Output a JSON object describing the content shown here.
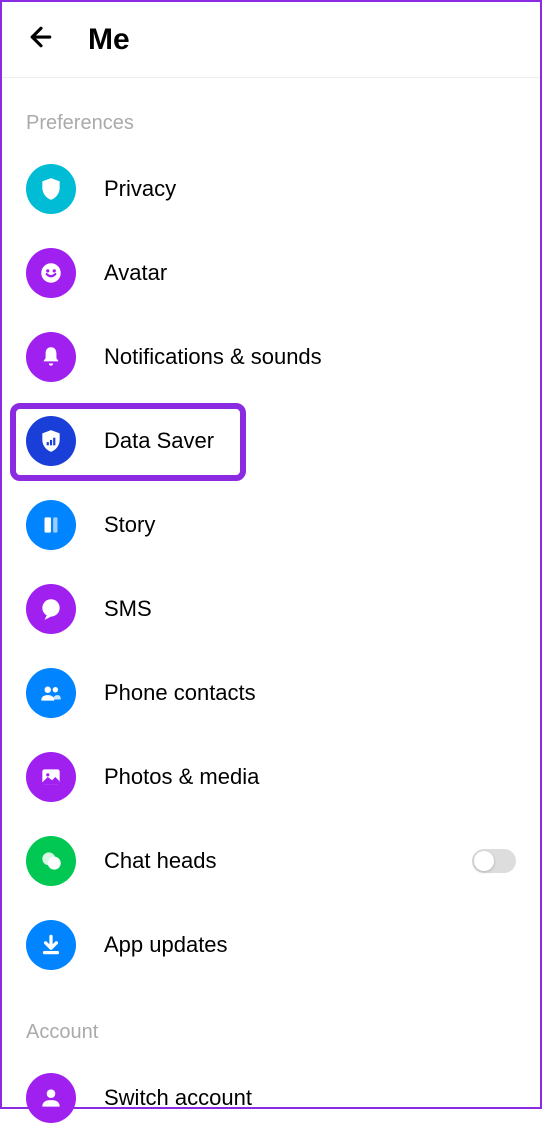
{
  "header": {
    "title": "Me"
  },
  "sections": {
    "preferences": {
      "label": "Preferences",
      "items": {
        "privacy": {
          "label": "Privacy"
        },
        "avatar": {
          "label": "Avatar"
        },
        "notifications": {
          "label": "Notifications & sounds"
        },
        "data_saver": {
          "label": "Data Saver"
        },
        "story": {
          "label": "Story"
        },
        "sms": {
          "label": "SMS"
        },
        "phone_contacts": {
          "label": "Phone contacts"
        },
        "photos_media": {
          "label": "Photos & media"
        },
        "chat_heads": {
          "label": "Chat heads",
          "toggle": false
        },
        "app_updates": {
          "label": "App updates"
        }
      }
    },
    "account": {
      "label": "Account",
      "items": {
        "switch_account": {
          "label": "Switch account"
        }
      }
    }
  },
  "colors": {
    "cyan": "#00bcd4",
    "purple": "#a020f0",
    "blue_dark": "#1a3fd8",
    "blue": "#0084ff",
    "green": "#00c853",
    "highlight": "#8a2be2"
  }
}
